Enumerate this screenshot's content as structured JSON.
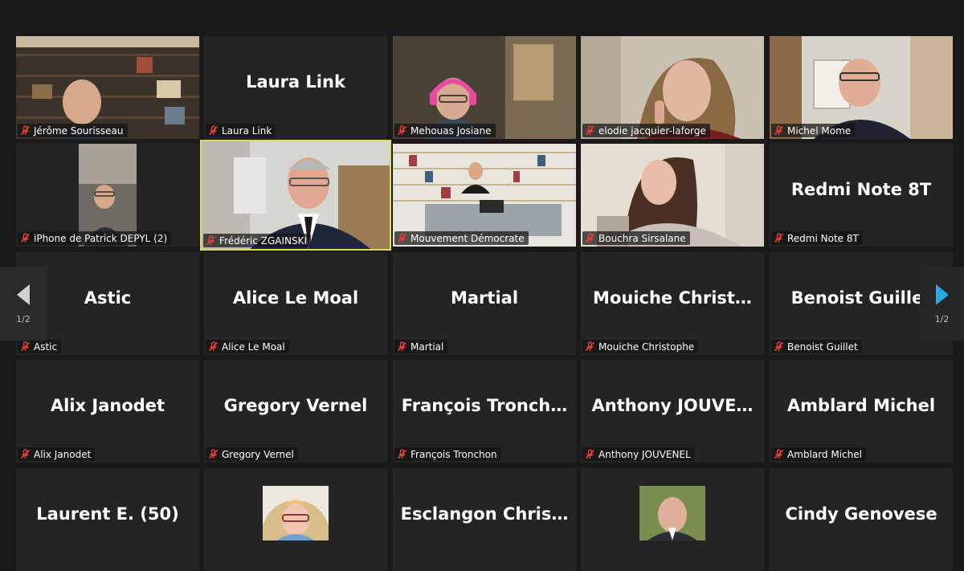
{
  "tiles": [
    {
      "name": "Jérôme Sourisseau",
      "type": "video",
      "scene": "bookshelf"
    },
    {
      "name": "Laura Link",
      "type": "name",
      "display": "Laura Link"
    },
    {
      "name": "Mehouas Josiane",
      "type": "video",
      "scene": "headphones"
    },
    {
      "name": "elodie jacquier-laforge",
      "type": "video",
      "scene": "woman"
    },
    {
      "name": "Michel Mome",
      "type": "video",
      "scene": "room"
    },
    {
      "name": "iPhone de Patrick DEPYL (2)",
      "type": "video",
      "scene": "phone"
    },
    {
      "name": "Frédéric ZGAINSKI",
      "type": "video",
      "scene": "speaker"
    },
    {
      "name": "Mouvement Démocrate",
      "type": "video",
      "scene": "office"
    },
    {
      "name": "Bouchra Sirsalane",
      "type": "video",
      "scene": "young-woman"
    },
    {
      "name": "Redmi Note 8T",
      "type": "name",
      "display": "Redmi Note 8T"
    },
    {
      "name": "Astic",
      "type": "name",
      "display": "Astic"
    },
    {
      "name": "Alice Le Moal",
      "type": "name",
      "display": "Alice Le Moal"
    },
    {
      "name": "Martial",
      "type": "name",
      "display": "Martial"
    },
    {
      "name": "Mouiche Christophe",
      "type": "name",
      "display": "Mouiche  Christ…"
    },
    {
      "name": "Benoist Guillet",
      "type": "name",
      "display": "Benoist Guillet"
    },
    {
      "name": "Alix Janodet",
      "type": "name",
      "display": "Alix Janodet"
    },
    {
      "name": "Gregory Vernel",
      "type": "name",
      "display": "Gregory Vernel"
    },
    {
      "name": "François Tronchon",
      "type": "name",
      "display": "François  Tronch…"
    },
    {
      "name": "Anthony JOUVENEL",
      "type": "name",
      "display": "Anthony  JOUVE…"
    },
    {
      "name": "Amblard Michel",
      "type": "name",
      "display": "Amblard Michel"
    },
    {
      "name": "",
      "type": "name",
      "display": "Laurent E. (50)"
    },
    {
      "name": "",
      "type": "avatar",
      "display": "",
      "avatar": "woman-glasses"
    },
    {
      "name": "",
      "type": "name",
      "display": "Esclangon  Chris…"
    },
    {
      "name": "",
      "type": "avatar",
      "display": "",
      "avatar": "man-bald"
    },
    {
      "name": "",
      "type": "name",
      "display": "Cindy Genovese"
    }
  ],
  "active_index": 6,
  "pagination": {
    "left": "1/2",
    "right": "1/2"
  },
  "colors": {
    "active_border": "#d8e24a",
    "muted_mic": "#e0403a",
    "nav_arrow_right": "#29a7e6",
    "nav_arrow_left": "#d0d0d0"
  }
}
